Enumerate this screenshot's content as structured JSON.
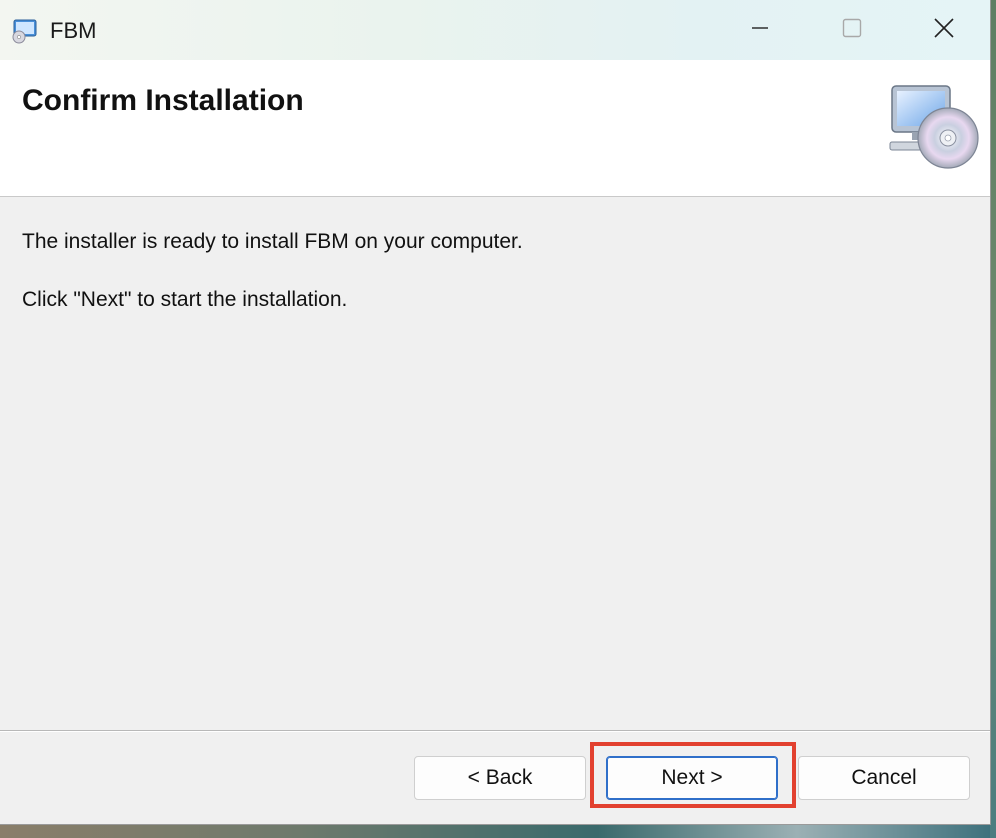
{
  "window": {
    "title": "FBM",
    "icon": "installer-monitor-cd-icon",
    "controls": {
      "minimize_icon": "minimize-icon",
      "maximize_icon": "maximize-icon",
      "close_icon": "close-icon"
    }
  },
  "header": {
    "title": "Confirm Installation",
    "icon": "computer-with-cd-icon"
  },
  "body": {
    "line1": "The installer is ready to install FBM on your computer.",
    "line2": "Click \"Next\" to start the installation."
  },
  "footer": {
    "back_label": "< Back",
    "next_label": "Next >",
    "cancel_label": "Cancel"
  },
  "colors": {
    "highlight": "#e2412f",
    "focus_border": "#2f6fc9",
    "dialog_bg": "#f0f0f0",
    "header_bg": "#ffffff"
  }
}
